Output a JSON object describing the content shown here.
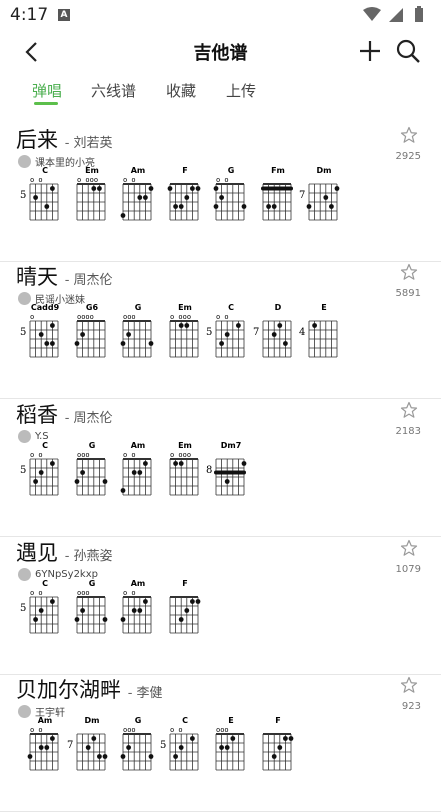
{
  "status": {
    "time": "4:17",
    "a_icon": "A"
  },
  "header": {
    "title": "吉他谱"
  },
  "tabs": [
    {
      "label": "弹唱",
      "active": true
    },
    {
      "label": "六线谱",
      "active": false
    },
    {
      "label": "收藏",
      "active": false
    },
    {
      "label": "上传",
      "active": false
    }
  ],
  "songs": [
    {
      "title": "后来",
      "sep": "-",
      "artist": "刘若英",
      "uploader": "课本里的小亮",
      "count": "2925",
      "chords": [
        {
          "name": "C",
          "fret": "5",
          "top": "o o",
          "dots": [
            [
              2,
              1
            ],
            [
              3,
              3
            ],
            [
              1,
              4
            ]
          ]
        },
        {
          "name": "Em",
          "fret": "",
          "top": "o   ooo",
          "dots": [
            [
              1,
              3
            ],
            [
              1,
              4
            ]
          ]
        },
        {
          "name": "Am",
          "fret": "",
          "top": "o   o",
          "dots": [
            [
              1,
              5
            ],
            [
              2,
              3
            ],
            [
              2,
              4
            ],
            [
              4,
              0
            ]
          ]
        },
        {
          "name": "F",
          "fret": "",
          "top": "",
          "dots": [
            [
              1,
              0
            ],
            [
              1,
              5
            ],
            [
              1,
              4
            ],
            [
              2,
              3
            ],
            [
              3,
              2
            ],
            [
              3,
              1
            ]
          ]
        },
        {
          "name": "G",
          "fret": "",
          "top": "o o",
          "dots": [
            [
              1,
              0
            ],
            [
              2,
              1
            ],
            [
              3,
              5
            ],
            [
              3,
              0
            ]
          ]
        },
        {
          "name": "Fm",
          "fret": "",
          "top": "",
          "bar": 1,
          "dots": [
            [
              3,
              1
            ],
            [
              3,
              2
            ]
          ]
        },
        {
          "name": "Dm",
          "fret": "7",
          "top": "",
          "dots": [
            [
              1,
              5
            ],
            [
              2,
              3
            ],
            [
              3,
              0
            ],
            [
              3,
              4
            ]
          ]
        }
      ]
    },
    {
      "title": "晴天",
      "sep": "-",
      "artist": "周杰伦",
      "uploader": "民谣小迷妹",
      "count": "5891",
      "chords": [
        {
          "name": "Cadd9",
          "fret": "5",
          "top": "o  ",
          "dots": [
            [
              2,
              2
            ],
            [
              3,
              3
            ],
            [
              3,
              4
            ],
            [
              1,
              4
            ]
          ]
        },
        {
          "name": "G6",
          "fret": "",
          "top": "oooo",
          "dots": [
            [
              2,
              1
            ],
            [
              3,
              0
            ]
          ]
        },
        {
          "name": "G",
          "fret": "",
          "top": "ooo",
          "dots": [
            [
              2,
              1
            ],
            [
              3,
              0
            ],
            [
              3,
              5
            ]
          ]
        },
        {
          "name": "Em",
          "fret": "",
          "top": "o  ooo",
          "dots": [
            [
              1,
              2
            ],
            [
              1,
              3
            ]
          ]
        },
        {
          "name": "C",
          "fret": "5",
          "top": "o o",
          "dots": [
            [
              1,
              4
            ],
            [
              2,
              2
            ],
            [
              3,
              1
            ]
          ]
        },
        {
          "name": "D",
          "fret": "7",
          "top": "",
          "dots": [
            [
              1,
              3
            ],
            [
              2,
              2
            ],
            [
              3,
              4
            ]
          ]
        },
        {
          "name": "E",
          "fret": "4",
          "top": "",
          "dots": [
            [
              1,
              1
            ]
          ]
        }
      ]
    },
    {
      "title": "稻香",
      "sep": "-",
      "artist": "周杰伦",
      "uploader": "Y.S",
      "count": "2183",
      "chords": [
        {
          "name": "C",
          "fret": "5",
          "top": "o o",
          "dots": [
            [
              1,
              4
            ],
            [
              2,
              2
            ],
            [
              3,
              1
            ]
          ]
        },
        {
          "name": "G",
          "fret": "",
          "top": "ooo",
          "dots": [
            [
              2,
              1
            ],
            [
              3,
              0
            ],
            [
              3,
              5
            ]
          ]
        },
        {
          "name": "Am",
          "fret": "",
          "top": "o   o",
          "dots": [
            [
              1,
              4
            ],
            [
              2,
              2
            ],
            [
              2,
              3
            ],
            [
              4,
              0
            ]
          ]
        },
        {
          "name": "Em",
          "fret": "",
          "top": "o  ooo",
          "dots": [
            [
              1,
              1
            ],
            [
              1,
              2
            ]
          ]
        },
        {
          "name": "Dm7",
          "fret": "8",
          "top": "",
          "bar": 2,
          "dots": [
            [
              1,
              5
            ],
            [
              3,
              2
            ]
          ]
        }
      ]
    },
    {
      "title": "遇见",
      "sep": "-",
      "artist": "孙燕姿",
      "uploader": "6YNpSy2kxp",
      "count": "1079",
      "chords": [
        {
          "name": "C",
          "fret": "5",
          "top": "o o",
          "dots": [
            [
              1,
              4
            ],
            [
              2,
              2
            ],
            [
              3,
              1
            ]
          ]
        },
        {
          "name": "G",
          "fret": "",
          "top": "ooo",
          "dots": [
            [
              2,
              1
            ],
            [
              3,
              0
            ],
            [
              3,
              5
            ]
          ]
        },
        {
          "name": "Am",
          "fret": "",
          "top": "o   o",
          "dots": [
            [
              1,
              4
            ],
            [
              2,
              2
            ],
            [
              2,
              3
            ],
            [
              3,
              0
            ]
          ]
        },
        {
          "name": "F",
          "fret": "",
          "top": "",
          "dots": [
            [
              1,
              4
            ],
            [
              1,
              5
            ],
            [
              2,
              3
            ],
            [
              3,
              2
            ]
          ]
        }
      ]
    },
    {
      "title": "贝加尔湖畔",
      "sep": "-",
      "artist": "李健",
      "uploader": "王宇轩",
      "count": "923",
      "chords": [
        {
          "name": "Am",
          "fret": "",
          "top": "o   o",
          "dots": [
            [
              1,
              4
            ],
            [
              2,
              2
            ],
            [
              2,
              3
            ],
            [
              3,
              0
            ]
          ]
        },
        {
          "name": "Dm",
          "fret": "7",
          "top": "",
          "dots": [
            [
              1,
              3
            ],
            [
              2,
              2
            ],
            [
              3,
              4
            ],
            [
              3,
              5
            ]
          ]
        },
        {
          "name": "G",
          "fret": "",
          "top": "ooo",
          "dots": [
            [
              2,
              1
            ],
            [
              3,
              0
            ],
            [
              3,
              5
            ]
          ]
        },
        {
          "name": "C",
          "fret": "5",
          "top": "o o",
          "dots": [
            [
              1,
              4
            ],
            [
              2,
              2
            ],
            [
              3,
              1
            ]
          ]
        },
        {
          "name": "E",
          "fret": "",
          "top": "ooo",
          "dots": [
            [
              1,
              3
            ],
            [
              2,
              1
            ],
            [
              2,
              2
            ]
          ]
        },
        {
          "name": "F",
          "fret": "",
          "top": "",
          "dots": [
            [
              1,
              4
            ],
            [
              1,
              5
            ],
            [
              2,
              3
            ],
            [
              3,
              2
            ]
          ]
        }
      ]
    }
  ]
}
